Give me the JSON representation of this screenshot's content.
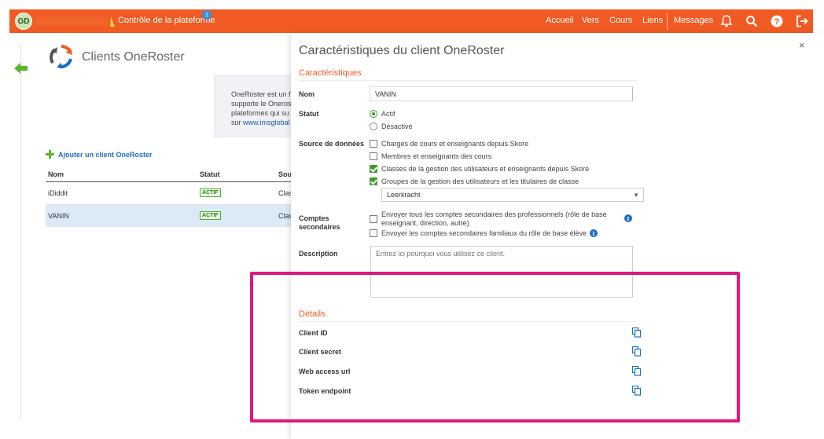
{
  "topbar": {
    "avatar_initials": "GD",
    "platform_label": "Contrôle de la plateforme",
    "notification_count": "1",
    "nav": [
      "Accueil",
      "Vers",
      "Cours",
      "Liens",
      "Messages"
    ],
    "icons": [
      "bell-icon",
      "search-icon",
      "help-icon",
      "logout-icon"
    ],
    "color": "#f15a22"
  },
  "page": {
    "title": "Clients OneRoster",
    "info_lines": [
      "OneRoster est un f",
      "supporte le Oneros",
      "plateformes qui su",
      "sur "
    ],
    "info_link": "www.imsglobal",
    "add_label": "Ajouter un client OneRoster",
    "columns": [
      "Nom",
      "Statut",
      "Sou"
    ],
    "rows": [
      {
        "name": "iDiddit",
        "status": "ACTIF",
        "source": "Clas"
      },
      {
        "name": "VANIN",
        "status": "ACTIF",
        "source": "Clas"
      }
    ]
  },
  "panel": {
    "title": "Caractéristiques du client OneRoster",
    "section_characteristics": "Caractéristiques",
    "name_label": "Nom",
    "name_value": "VANIN",
    "status_label": "Statut",
    "status_options": [
      "Actif",
      "Désactivé"
    ],
    "status_selected": "Actif",
    "source_label": "Source de données",
    "sources": [
      {
        "label": "Charges de cours et enseignants depuis Skore",
        "checked": false
      },
      {
        "label": "Membres et enseignants des cours",
        "checked": false
      },
      {
        "label": "Classes de la gestion des utilisateurs et enseignants depuis Skore",
        "checked": true
      },
      {
        "label": "Groupes de la gestion des utilisateurs et les titulaires de classe",
        "checked": true
      }
    ],
    "source_select_value": "Leerkracht",
    "secondary_label_1": "Comptes",
    "secondary_label_2": "secondaires",
    "secondary_option_1a": "Envoyer tous les comptes secondaires des professionnels (rôle de base",
    "secondary_option_1b": "enseignant, direction, autre)",
    "secondary_option_2": "Envoyer les comptes secondaires familiaux du rôle de base élève",
    "description_label": "Description",
    "description_placeholder": "Entrez ici pourquoi vous utilisez ce client.",
    "section_details": "Détails",
    "details": [
      "Client ID",
      "Client secret",
      "Web access url",
      "Token endpoint"
    ],
    "close_symbol": "×"
  },
  "colors": {
    "accent": "#f15a22",
    "highlight": "#e0177f",
    "active_green": "#3d9b2a",
    "link_blue": "#1b6fc2"
  }
}
